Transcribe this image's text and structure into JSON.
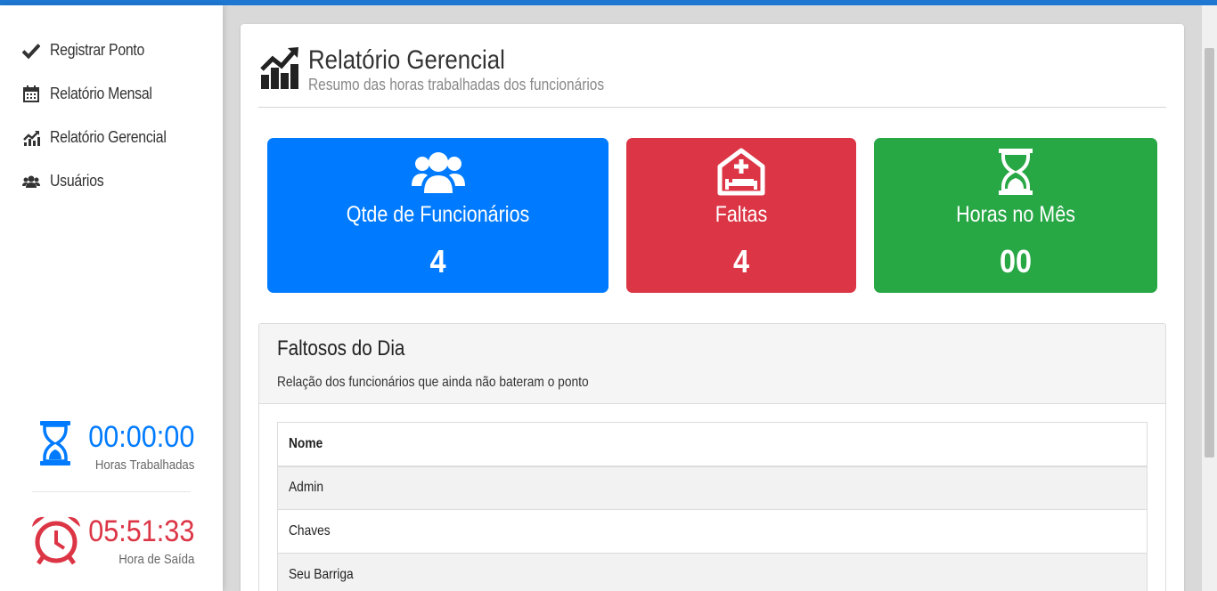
{
  "sidebar": {
    "items": [
      {
        "label": "Registrar Ponto",
        "icon": "check-icon"
      },
      {
        "label": "Relatório Mensal",
        "icon": "calendar-icon"
      },
      {
        "label": "Relatório Gerencial",
        "icon": "chart-line-icon"
      },
      {
        "label": "Usuários",
        "icon": "users-icon"
      }
    ],
    "worked": {
      "time": "00:00:00",
      "label": "Horas Trabalhadas",
      "color": "#007bff",
      "icon": "hourglass-icon"
    },
    "exit": {
      "time": "05:51:33",
      "label": "Hora de Saída",
      "color": "#dc3545",
      "icon": "alarm-clock-icon"
    }
  },
  "header": {
    "title": "Relatório Gerencial",
    "subtitle": "Resumo das horas trabalhadas dos funcionários",
    "icon": "chart-line-icon"
  },
  "stats": {
    "employees": {
      "title": "Qtde de Funcionários",
      "value": "4",
      "color": "#007bff",
      "icon": "users-icon"
    },
    "absences": {
      "title": "Faltas",
      "value": "4",
      "color": "#dc3545",
      "icon": "hospital-bed-icon"
    },
    "hours": {
      "title": "Horas no Mês",
      "value": "00",
      "color": "#28a745",
      "icon": "hourglass-icon"
    }
  },
  "absent": {
    "title": "Faltosos do Dia",
    "description": "Relação dos funcionários que ainda não bateram o ponto",
    "column": "Nome",
    "rows": [
      "Admin",
      "Chaves",
      "Seu Barriga"
    ]
  }
}
